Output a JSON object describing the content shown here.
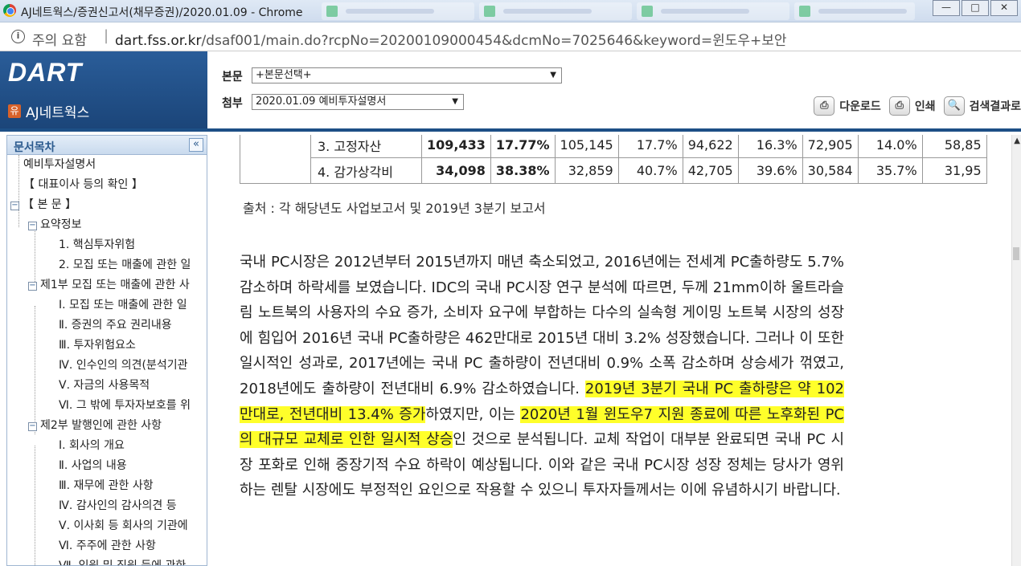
{
  "window": {
    "title": "AJ네트웍스/증권신고서(채무증권)/2020.01.09 - Chrome",
    "controls": [
      "—",
      "□",
      "✕"
    ]
  },
  "address_bar": {
    "status": "주의 요함",
    "host": "dart.fss.or.kr",
    "path": "/dsaf001/main.do?rcpNo=20200109000454&dcmNo=7025646&keyword=윈도우+보안"
  },
  "header": {
    "logo": "DART",
    "company_badge": "유",
    "company": "AJ네트웍스",
    "body_label": "본문",
    "body_select": "+본문선택+",
    "attach_label": "첨부",
    "attach_select": "2020.01.09  예비투자설명서",
    "buttons": [
      {
        "icon": "⎙",
        "label": "다운로드"
      },
      {
        "icon": "⎙",
        "label": "인쇄"
      },
      {
        "icon": "🔍",
        "label": "검색결과로"
      }
    ]
  },
  "sidebar": {
    "title": "문서목차",
    "collapse": "«",
    "items": [
      {
        "label": "예비투자설명서"
      },
      {
        "label": "【 대표이사 등의 확인 】"
      },
      {
        "label": "【 본 문 】"
      },
      {
        "label": "요약정보"
      },
      {
        "label": "1. 핵심투자위험"
      },
      {
        "label": "2. 모집 또는 매출에 관한 일"
      },
      {
        "label": "제1부 모집 또는 매출에 관한 사"
      },
      {
        "label": "Ⅰ. 모집 또는 매출에 관한 일"
      },
      {
        "label": "Ⅱ. 증권의 주요 권리내용"
      },
      {
        "label": "Ⅲ. 투자위험요소"
      },
      {
        "label": "Ⅳ. 인수인의 의견(분석기관"
      },
      {
        "label": "Ⅴ. 자금의 사용목적"
      },
      {
        "label": "Ⅵ. 그 밖에 투자자보호를 위"
      },
      {
        "label": "제2부 발행인에 관한 사항"
      },
      {
        "label": "Ⅰ. 회사의 개요"
      },
      {
        "label": "Ⅱ. 사업의 내용"
      },
      {
        "label": "Ⅲ. 재무에 관한 사항"
      },
      {
        "label": "Ⅳ. 감사인의 감사의견 등"
      },
      {
        "label": "Ⅴ. 이사회 등 회사의 기관에"
      },
      {
        "label": "Ⅵ. 주주에 관한 사항"
      },
      {
        "label": "Ⅶ. 임원 및 직원 등에 관한"
      }
    ]
  },
  "table": {
    "rows": [
      {
        "label": "3. 고정자산",
        "cells": [
          "109,433",
          "17.77%",
          "105,145",
          "17.7%",
          "94,622",
          "16.3%",
          "72,905",
          "14.0%",
          "58,85"
        ]
      },
      {
        "label": "4. 감가상각비",
        "cells": [
          "34,098",
          "38.38%",
          "32,859",
          "40.7%",
          "42,705",
          "39.6%",
          "30,584",
          "35.7%",
          "31,95"
        ]
      }
    ]
  },
  "source_note": "출처 : 각 해당년도 사업보고서 및 2019년 3분기 보고서",
  "paragraph": {
    "p1": "국내 PC시장은 2012년부터 2015년까지 매년 축소되었고, 2016년에는 전세계 PC출하량도 5.7% 감소하며 하락세를 보였습니다. IDC의 국내 PC시장 연구 분석에 따르면, 두께 21mm이하 울트라슬림 노트북의 사용자의 수요 증가, 소비자 요구에 부합하는 다수의 실속형 게이밍 노트북 시장의 성장에 힘입어 2016년 국내 PC출하량은 462만대로 2015년 대비 3.2% 성장했습니다. 그러나 이 또한 일시적인 성과로, 2017년에는 국내 PC 출하량이 전년대비 0.9% 소폭 감소하며 상승세가 꺾였고, 2018년에도 출하량이 전년대비 6.9% 감소하였습니다. ",
    "h1": "2019년 3분기 국내 PC 출하량은 약 102만대로, 전년대비 13.4% 증가",
    "p2": "하였지만, 이는 ",
    "h2": "2020년 1월 윈도우7 지원 종료에 따른 노후화된 PC의 대규모 교체로 인한 일시적 상승",
    "p3": "인 것으로 분석됩니다. 교체 작업이 대부분 완료되면 국내 PC 시장 포화로 인해 중장기적 수요 하락이 예상됩니다. 이와 같은 국내 PC시장 성장 정체는 당사가 영위하는 렌탈 시장에도 부정적인 요인으로 작용할 수 있으니 투자자들께서는 이에 유념하시기 바랍니다."
  },
  "colors": {
    "highlight": "#ffff2a",
    "dart_blue": "#1d4f86"
  }
}
